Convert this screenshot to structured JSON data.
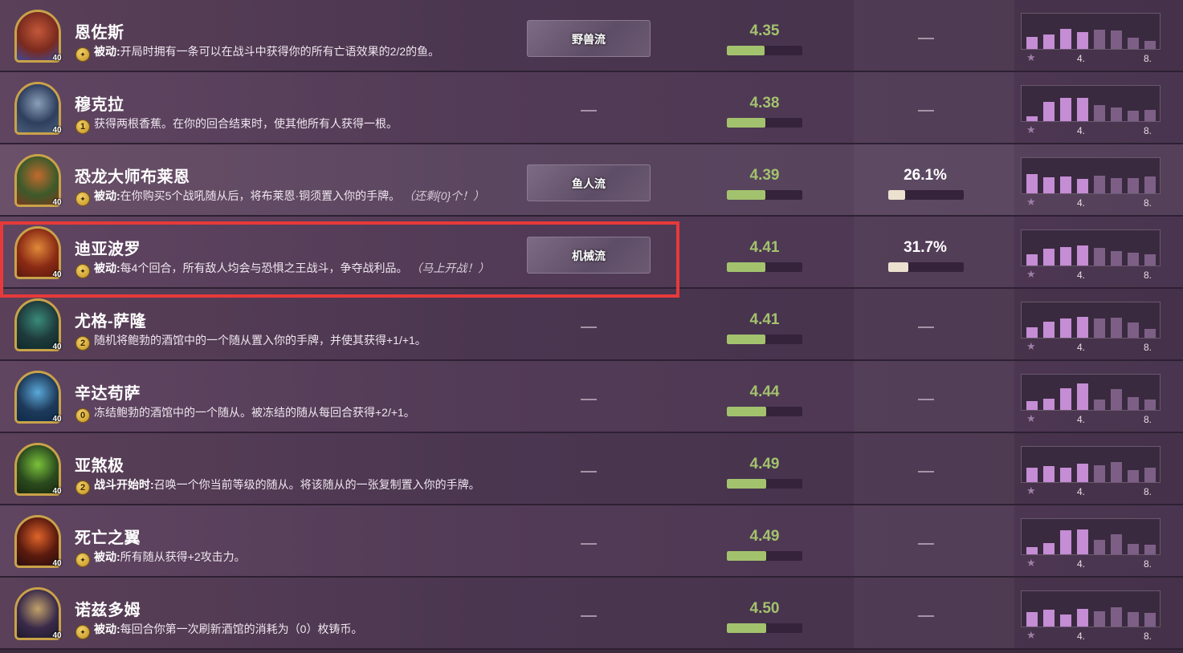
{
  "heroes": [
    {
      "name": "恩佐斯",
      "armor": "40",
      "cost": "",
      "desc_prefix": "被动:",
      "desc": "开局时拥有一条可以在战斗中获得你的所有亡语效果的2/2的鱼。",
      "desc_extra": "",
      "build": "野兽流",
      "avg_place": "4.35",
      "avg_place_value": 4.35,
      "pick_rate": "",
      "dist": [
        0.38,
        0.45,
        0.62,
        0.52,
        0.6,
        0.58,
        0.35,
        0.25
      ],
      "dist_labels": [
        "4.",
        "8."
      ],
      "portrait_colors": [
        "#7a2a1e",
        "#c4583a",
        "#3c4a9a"
      ]
    },
    {
      "name": "穆克拉",
      "armor": "40",
      "cost": "1",
      "desc_prefix": "",
      "desc": "获得两根香蕉。在你的回合结束时，使其他所有人获得一根。",
      "desc_extra": "",
      "build": "",
      "avg_place": "4.38",
      "avg_place_value": 4.38,
      "pick_rate": "",
      "dist": [
        0.15,
        0.6,
        0.72,
        0.72,
        0.5,
        0.42,
        0.32,
        0.35
      ],
      "dist_labels": [
        "4.",
        "8."
      ],
      "portrait_colors": [
        "#2e3f5e",
        "#8b9fb8",
        "#4a5f7a"
      ]
    },
    {
      "name": "恐龙大师布莱恩",
      "armor": "40",
      "cost": "",
      "desc_prefix": "被动:",
      "desc": "在你购买5个战吼随从后，将布莱恩·铜须置入你的手牌。",
      "desc_extra": "（还剩{0}个！）",
      "build": "鱼人流",
      "avg_place": "4.39",
      "avg_place_value": 4.39,
      "pick_rate": "26.1%",
      "pick_rate_value": 0.261,
      "dist": [
        0.6,
        0.5,
        0.52,
        0.46,
        0.55,
        0.48,
        0.48,
        0.52
      ],
      "dist_labels": [
        "4.",
        "8."
      ],
      "portrait_colors": [
        "#3c5a2a",
        "#c26a2e",
        "#7a3a1e"
      ]
    },
    {
      "name": "迪亚波罗",
      "armor": "40",
      "cost": "",
      "desc_prefix": "被动:",
      "desc": "每4个回合，所有敌人均会与恐惧之王战斗，争夺战利品。",
      "desc_extra": "（马上开战！）",
      "build": "机械流",
      "avg_place": "4.41",
      "avg_place_value": 4.41,
      "pick_rate": "31.7%",
      "pick_rate_value": 0.317,
      "dist": [
        0.35,
        0.52,
        0.58,
        0.62,
        0.55,
        0.45,
        0.4,
        0.35
      ],
      "dist_labels": [
        "4.",
        "8."
      ],
      "portrait_colors": [
        "#8a2a14",
        "#e08a3a",
        "#5a1a0e"
      ]
    },
    {
      "name": "尤格-萨隆",
      "armor": "40",
      "cost": "2",
      "desc_prefix": "",
      "desc": "随机将鲍勃的酒馆中的一个随从置入你的手牌，并使其获得+1/+1。",
      "desc_extra": "",
      "build": "",
      "avg_place": "4.41",
      "avg_place_value": 4.41,
      "pick_rate": "",
      "dist": [
        0.32,
        0.5,
        0.6,
        0.65,
        0.6,
        0.62,
        0.48,
        0.28
      ],
      "dist_labels": [
        "4.",
        "8."
      ],
      "portrait_colors": [
        "#1e3a3a",
        "#3a8a7a",
        "#0e2a2a"
      ]
    },
    {
      "name": "辛达苟萨",
      "armor": "40",
      "cost": "0",
      "desc_prefix": "",
      "desc": "冻结鲍勃的酒馆中的一个随从。被冻结的随从每回合获得+2/+1。",
      "desc_extra": "",
      "build": "",
      "avg_place": "4.44",
      "avg_place_value": 4.44,
      "pick_rate": "",
      "dist": [
        0.28,
        0.35,
        0.68,
        0.82,
        0.32,
        0.65,
        0.4,
        0.32
      ],
      "dist_labels": [
        "4.",
        "8."
      ],
      "portrait_colors": [
        "#1e3a5a",
        "#5aa8d8",
        "#0e2a4a"
      ]
    },
    {
      "name": "亚煞极",
      "armor": "40",
      "cost": "2",
      "desc_prefix": "战斗开始时:",
      "desc": "召唤一个你当前等级的随从。将该随从的一张复制置入你的手牌。",
      "desc_extra": "",
      "build": "",
      "avg_place": "4.49",
      "avg_place_value": 4.49,
      "pick_rate": "",
      "dist": [
        0.45,
        0.5,
        0.45,
        0.58,
        0.52,
        0.62,
        0.38,
        0.45
      ],
      "dist_labels": [
        "4.",
        "8."
      ],
      "portrait_colors": [
        "#2a4a1e",
        "#7ac23a",
        "#1a2a0e"
      ]
    },
    {
      "name": "死亡之翼",
      "armor": "40",
      "cost": "",
      "desc_prefix": "被动:",
      "desc": "所有随从获得+2攻击力。",
      "desc_extra": "",
      "build": "",
      "avg_place": "4.49",
      "avg_place_value": 4.49,
      "pick_rate": "",
      "dist": [
        0.22,
        0.35,
        0.75,
        0.78,
        0.45,
        0.62,
        0.32,
        0.3
      ],
      "dist_labels": [
        "4.",
        "8."
      ],
      "portrait_colors": [
        "#5a1a0e",
        "#e0642a",
        "#2a0e0e"
      ]
    },
    {
      "name": "诺兹多姆",
      "armor": "40",
      "cost": "",
      "desc_prefix": "被动:",
      "desc": "每回合你第一次刷新酒馆的消耗为（0）枚铸币。",
      "desc_extra": "",
      "build": "",
      "avg_place": "4.50",
      "avg_place_value": 4.5,
      "pick_rate": "",
      "dist": [
        0.45,
        0.52,
        0.38,
        0.55,
        0.48,
        0.6,
        0.45,
        0.42
      ],
      "dist_labels": [
        "4.",
        "8."
      ],
      "portrait_colors": [
        "#3a2a4a",
        "#c2a26a",
        "#1e1a2a"
      ]
    }
  ],
  "colors": {
    "place_green": "#a3c26e",
    "top4_bar": "#c48dd4",
    "bot4_bar": "#7d5f86",
    "highlight": "#e63a3a"
  },
  "icons": {
    "coin": "coin-icon",
    "star": "star-icon"
  }
}
